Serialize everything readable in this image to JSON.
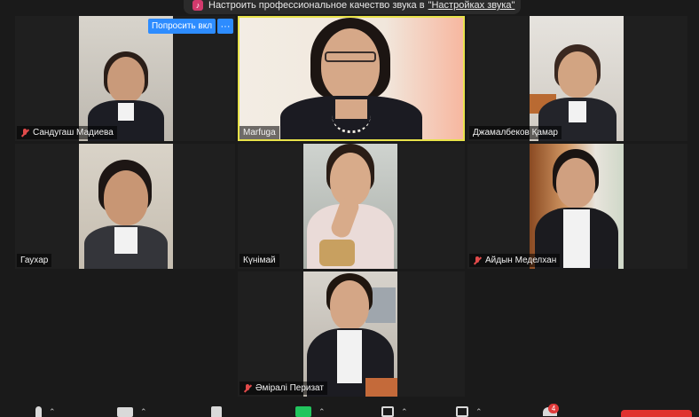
{
  "banner": {
    "text": "Настроить профессиональное качество звука в",
    "link": "\"Настройках звука\""
  },
  "overlay": {
    "request_label": "Попросить вкл",
    "more_label": "···"
  },
  "participants": [
    {
      "name": "Сандугаш Мадиева",
      "muted": true
    },
    {
      "name": "Marfuga",
      "muted": false,
      "active_speaker": true
    },
    {
      "name": "Джамалбеков Қамар",
      "muted": false
    },
    {
      "name": "Гаухар",
      "muted": false
    },
    {
      "name": "Күнімай",
      "muted": false
    },
    {
      "name": "Айдын Меделхан",
      "muted": true
    },
    {
      "name": "Әміралі Перизат",
      "muted": true
    }
  ],
  "toolbar": {
    "badge_count": "4"
  },
  "colors": {
    "active_border": "#e8e24a",
    "accent_blue": "#2d8cff",
    "mute_red": "#e04a4a",
    "end_red": "#e0312f"
  },
  "icons": [
    "music-icon",
    "mute-icon",
    "microphone-icon",
    "video-camera-icon",
    "security-shield-icon",
    "share-screen-icon",
    "record-icon",
    "more-icon",
    "participants-icon"
  ]
}
